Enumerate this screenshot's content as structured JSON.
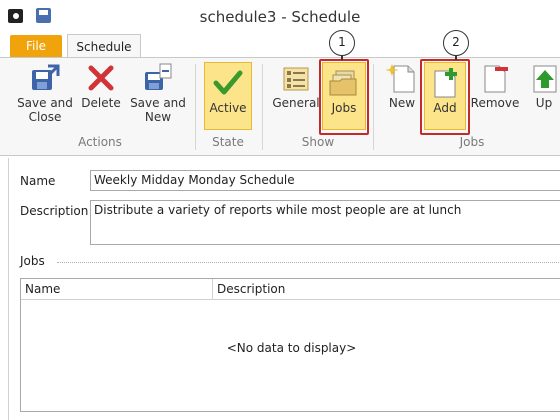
{
  "window": {
    "title": "schedule3 - Schedule"
  },
  "tabs": {
    "file": "File",
    "schedule": "Schedule"
  },
  "ribbon": {
    "actions": {
      "label": "Actions",
      "save_close": [
        "Save and",
        "Close"
      ],
      "delete": "Delete",
      "save_new": [
        "Save and",
        "New"
      ]
    },
    "state": {
      "label": "State",
      "active": "Active"
    },
    "show": {
      "label": "Show",
      "general": "General",
      "jobs": "Jobs"
    },
    "jobs": {
      "label": "Jobs",
      "new": "New",
      "add": "Add",
      "remove": "Remove",
      "up": "Up"
    }
  },
  "callouts": [
    "1",
    "2"
  ],
  "form": {
    "name_label": "Name",
    "name_value": "Weekly Midday Monday Schedule",
    "description_label": "Description",
    "description_value": "Distribute a variety of reports while most people are at lunch",
    "jobs_label": "Jobs",
    "grid": {
      "columns": [
        "Name",
        "Description"
      ],
      "empty_text": "<No data to display>"
    }
  },
  "icons": {
    "save_close": "save-close-icon",
    "delete": "delete-icon",
    "save_new": "save-new-icon",
    "active": "checkmark-icon",
    "general": "general-icon",
    "jobs": "jobs-folder-icon",
    "new": "new-document-icon",
    "add": "add-icon",
    "remove": "remove-icon",
    "up": "up-arrow-icon"
  }
}
